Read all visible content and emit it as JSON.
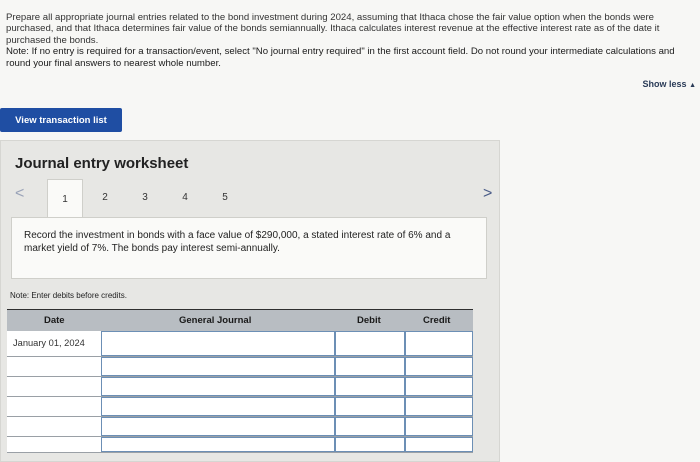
{
  "intro": {
    "paragraph": "Prepare all appropriate journal entries related to the bond investment during 2024, assuming that Ithaca chose the fair value option when the bonds were purchased, and that Ithaca determines fair value of the bonds semiannually. Ithaca calculates interest revenue at the effective interest rate as of the date it purchased the bonds.",
    "note": "Note: If no entry is required for a transaction/event, select \"No journal entry required\" in the first account field. Do not round your intermediate calculations and round your final answers to nearest whole number."
  },
  "show_less": {
    "label": "Show less",
    "icon": "triangle-up-icon"
  },
  "view_button": {
    "label": "View transaction list"
  },
  "worksheet": {
    "title": "Journal entry worksheet",
    "tabs": [
      "1",
      "2",
      "3",
      "4",
      "5"
    ],
    "active_tab": "1",
    "description": "Record the investment in bonds with a face value of $290,000, a stated interest rate of 6% and a market yield of 7%. The bonds pay interest semi-annually.",
    "note": "Note: Enter debits before credits.",
    "table": {
      "headers": {
        "date": "Date",
        "account": "General Journal",
        "debit": "Debit",
        "credit": "Credit"
      },
      "rows": [
        {
          "date": "January 01, 2024"
        },
        {
          "date": ""
        },
        {
          "date": ""
        },
        {
          "date": ""
        },
        {
          "date": ""
        },
        {
          "date": ""
        }
      ]
    }
  },
  "colors": {
    "button_bg": "#1f4ea3",
    "input_border": "#6c8fb5",
    "header_bg": "#b8bdc2"
  }
}
